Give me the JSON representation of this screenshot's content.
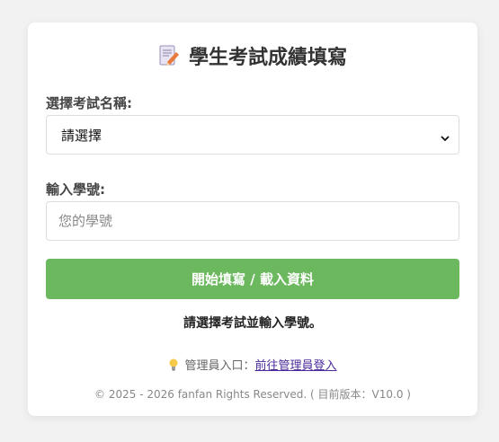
{
  "header": {
    "title": "學生考試成績填寫",
    "icon": "memo-pencil-icon"
  },
  "form": {
    "exam_label": "選擇考試名稱:",
    "exam_select_value": "請選擇",
    "student_id_label": "輸入學號:",
    "student_id_placeholder": "您的學號",
    "student_id_value": "",
    "submit_label": "開始填寫 / 載入資料"
  },
  "status_message": "請選擇考試並輸入學號。",
  "admin": {
    "icon": "lightbulb-icon",
    "prefix": "管理員入口：",
    "link_text": "前往管理員登入"
  },
  "footer": {
    "copyright": "© 2025 - 2026 fanfan Rights Reserved. ( 目前版本：V10.0 )"
  },
  "colors": {
    "accent": "#6cb85f",
    "link": "#4b2a9c",
    "background": "#f2f2f2"
  }
}
